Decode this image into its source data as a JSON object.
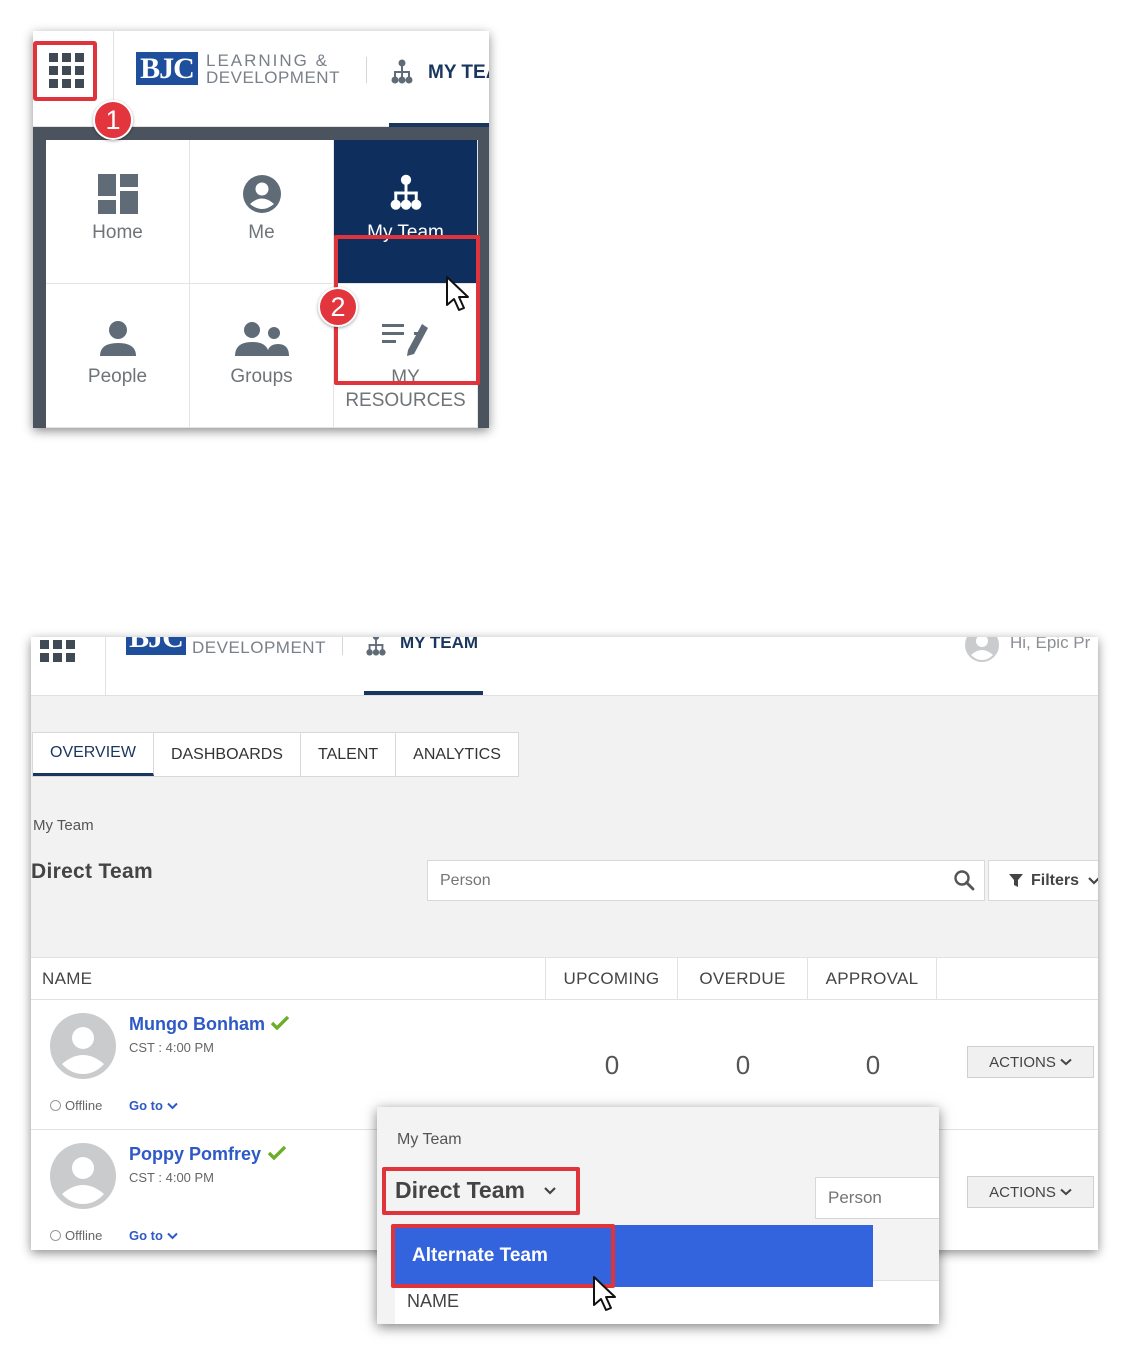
{
  "brand": {
    "logo_text": "BJC",
    "line1": "LEARNING &",
    "line2": "DEVELOPMENT"
  },
  "nav": {
    "my_team": "MY TEAM",
    "my_team_cropped": "MY TEA",
    "greeting": "Hi, Epic Pr"
  },
  "step_badges": [
    "1",
    "2"
  ],
  "launcher": {
    "tiles": [
      {
        "label": "Home",
        "icon": "dashboard-icon"
      },
      {
        "label": "Me",
        "icon": "account-circle-icon"
      },
      {
        "label": "My Team",
        "icon": "org-chart-icon"
      },
      {
        "label": "People",
        "icon": "person-icon"
      },
      {
        "label": "Groups",
        "icon": "group-icon"
      },
      {
        "label": "MY RESOURCES",
        "line1": "MY",
        "line2": "RESOURCES",
        "icon": "edit-notes-icon"
      }
    ]
  },
  "tabs": [
    {
      "label": "OVERVIEW",
      "active": true
    },
    {
      "label": "DASHBOARDS",
      "active": false
    },
    {
      "label": "TALENT",
      "active": false
    },
    {
      "label": "ANALYTICS",
      "active": false
    }
  ],
  "breadcrumb": "My Team",
  "view_title": "Direct Team",
  "search": {
    "placeholder": "Person"
  },
  "filters_label": "Filters",
  "table": {
    "headers": {
      "name": "NAME",
      "upcoming": "UPCOMING",
      "overdue": "OVERDUE",
      "approval": "APPROVAL"
    },
    "rows": [
      {
        "name": "Mungo Bonham",
        "timezone": "CST : 4:00 PM",
        "status": "Offline",
        "goto": "Go to",
        "upcoming": "0",
        "overdue": "0",
        "approval": "0",
        "actions": "ACTIONS"
      },
      {
        "name": "Poppy Pomfrey",
        "timezone": "CST : 4:00 PM",
        "status": "Offline",
        "goto": "Go to",
        "actions": "ACTIONS"
      }
    ]
  },
  "dropdown": {
    "crumb": "My Team",
    "selected": "Direct Team",
    "option": "Alternate Team",
    "search_placeholder": "Person",
    "name_header": "NAME"
  },
  "colors": {
    "navy": "#0e2f5d",
    "brand_blue": "#1e4e9c",
    "link_blue": "#2e59c6",
    "highlight_red": "#e0343c",
    "option_blue": "#3464dd",
    "check_green": "#6cae2b"
  }
}
